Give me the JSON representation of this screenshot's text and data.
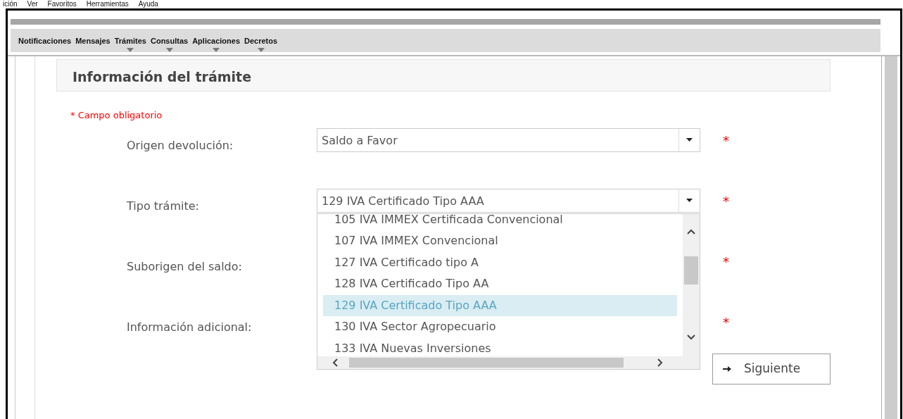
{
  "menu_bar": [
    "ición",
    "Ver",
    "Favoritos",
    "Herramientas",
    "Ayuda"
  ],
  "nav": [
    {
      "label": "Notificaciones",
      "has_dropdown": false
    },
    {
      "label": "Mensajes",
      "has_dropdown": false
    },
    {
      "label": "Trámites",
      "has_dropdown": true
    },
    {
      "label": "Consultas",
      "has_dropdown": true
    },
    {
      "label": "Aplicaciones",
      "has_dropdown": true
    },
    {
      "label": "Decretos",
      "has_dropdown": true
    }
  ],
  "section_title": "Información del trámite",
  "required_note": "* Campo obligatorio",
  "fields": [
    {
      "label": "Origen devolución:",
      "value": "Saldo a Favor",
      "required_mark": "*"
    },
    {
      "label": "Tipo trámite:",
      "value": "129 IVA Certificado Tipo AAA",
      "required_mark": "*",
      "open": true,
      "options": [
        {
          "label": "105 IVA IMMEX Certificada Convencional",
          "selected": false
        },
        {
          "label": "107 IVA IMMEX Convencional",
          "selected": false
        },
        {
          "label": "127 IVA Certificado tipo A",
          "selected": false
        },
        {
          "label": "128 IVA Certificado Tipo AA",
          "selected": false
        },
        {
          "label": "129 IVA Certificado Tipo AAA",
          "selected": true
        },
        {
          "label": "130 IVA Sector Agropecuario",
          "selected": false
        },
        {
          "label": "133 IVA Nuevas Inversiones",
          "selected": false
        }
      ]
    },
    {
      "label": "Suborigen del saldo:",
      "required_mark": "*"
    },
    {
      "label": "Información adicional:",
      "required_mark": "*"
    }
  ],
  "next_button": "Siguiente"
}
